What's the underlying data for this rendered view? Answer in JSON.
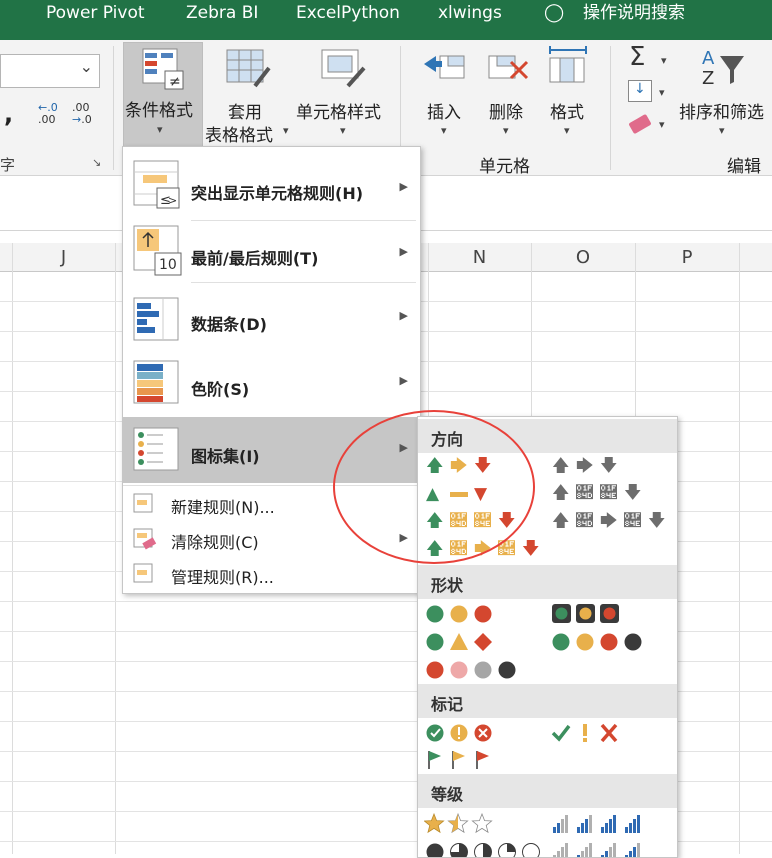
{
  "ribbon": {
    "tabs": [
      "Power Pivot",
      "Zebra BI",
      "ExcelPython",
      "xlwings"
    ],
    "tell_me": "操作说明搜索",
    "buttons": {
      "conditional_format": "条件格式",
      "table_format_line1": "套用",
      "table_format_line2": "表格格式",
      "cell_styles": "单元格样式",
      "insert": "插入",
      "delete": "删除",
      "format": "格式",
      "sort_filter": "排序和筛选"
    },
    "number_group_fragment": "字",
    "decimal_inc": ".0\n.00",
    "decimal_dec": ".00\n→.0",
    "cells_group": "单元格",
    "edit_group": "编辑"
  },
  "sheet": {
    "columns": [
      "J",
      "N",
      "O",
      "P"
    ]
  },
  "menu": {
    "items": [
      {
        "label": "突出显示单元格规则(H)"
      },
      {
        "label": "最前/最后规则(T)"
      },
      {
        "label": "数据条(D)"
      },
      {
        "label": "色阶(S)"
      },
      {
        "label": "图标集(I)"
      }
    ],
    "small_items": [
      {
        "label": "新建规则(N)..."
      },
      {
        "label": "清除规则(C)"
      },
      {
        "label": "管理规则(R)..."
      }
    ],
    "top10_icon_text": "10"
  },
  "submenu": {
    "sections": [
      "方向",
      "形状",
      "标记",
      "等级"
    ]
  },
  "colors": {
    "excel_green": "#217346",
    "icon_green": "#3c8f5e",
    "icon_yellow": "#e8b04b",
    "icon_red": "#d4472f",
    "icon_gray": "#6d6d6d",
    "annotation_red": "#e8413a"
  }
}
